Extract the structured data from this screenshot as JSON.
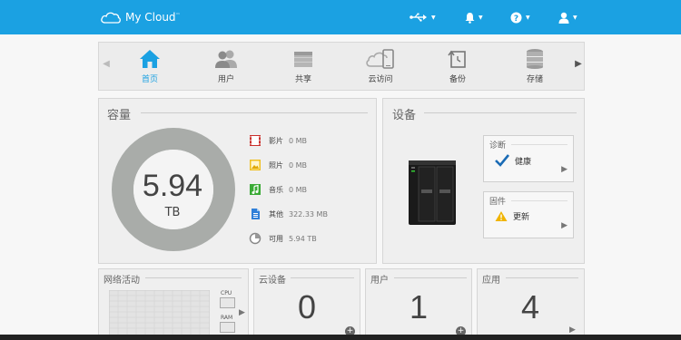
{
  "header": {
    "brand": "My Cloud",
    "brand_mark": "™",
    "icons": [
      "usb-icon",
      "bell-icon",
      "help-icon",
      "user-icon"
    ],
    "accent": "#1ba1e2"
  },
  "nav": {
    "items": [
      {
        "label": "首页",
        "icon": "home-icon",
        "active": true
      },
      {
        "label": "用户",
        "icon": "users-icon"
      },
      {
        "label": "共享",
        "icon": "folder-icon"
      },
      {
        "label": "云访问",
        "icon": "cloud-access-icon"
      },
      {
        "label": "备份",
        "icon": "backup-icon"
      },
      {
        "label": "存储",
        "icon": "storage-icon"
      }
    ]
  },
  "capacity": {
    "title": "容量",
    "total": "5.94",
    "unit": "TB",
    "used_fraction": 0.0001,
    "legend": [
      {
        "name": "影片",
        "value": "0 MB",
        "icon": "video-icon"
      },
      {
        "name": "照片",
        "value": "0 MB",
        "icon": "photo-icon"
      },
      {
        "name": "音乐",
        "value": "0 MB",
        "icon": "music-icon"
      },
      {
        "name": "其他",
        "value": "322.33 MB",
        "icon": "document-icon"
      },
      {
        "name": "可用",
        "value": "5.94 TB",
        "icon": "pie-icon"
      }
    ]
  },
  "device": {
    "title": "设备",
    "diagnostics": {
      "title": "诊断",
      "status": "健康"
    },
    "firmware": {
      "title": "固件",
      "status": "更新"
    }
  },
  "network": {
    "title": "网络活动",
    "cpu_label": "CPU",
    "ram_label": "RAM"
  },
  "cloud_devices": {
    "title": "云设备",
    "count": "0"
  },
  "users": {
    "title": "用户",
    "count": "1"
  },
  "apps": {
    "title": "应用",
    "count": "4"
  }
}
